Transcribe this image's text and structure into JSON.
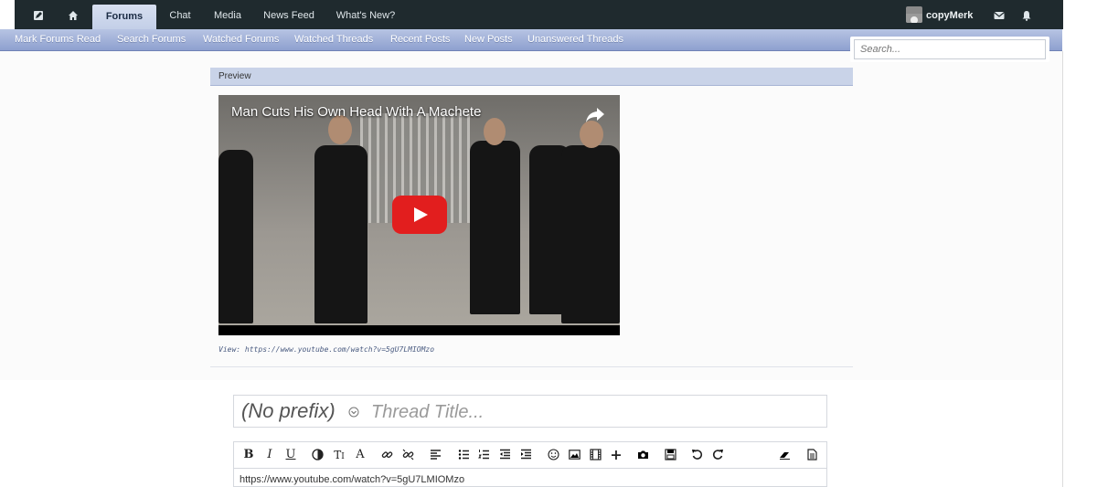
{
  "topnav": {
    "items": [
      {
        "label": "Forums"
      },
      {
        "label": "Chat"
      },
      {
        "label": "Media"
      },
      {
        "label": "News Feed"
      },
      {
        "label": "What's New?"
      }
    ],
    "username": "copyMerk"
  },
  "subnav": {
    "items": [
      {
        "label": "Mark Forums Read"
      },
      {
        "label": "Search Forums"
      },
      {
        "label": "Watched Forums"
      },
      {
        "label": "Watched Threads"
      },
      {
        "label": "Recent Posts"
      },
      {
        "label": "New Posts"
      },
      {
        "label": "Unanswered Threads"
      }
    ]
  },
  "search": {
    "placeholder": "Search..."
  },
  "preview": {
    "label": "Preview",
    "video_title": "Man Cuts His Own Head With A Machete",
    "view_label": "View:",
    "view_url": "https://www.youtube.com/watch?v=5gU7LMIOMzo"
  },
  "editor": {
    "prefix": "(No prefix)",
    "title_placeholder": "Thread Title...",
    "body_text": "https://www.youtube.com/watch?v=5gU7LMIOMzo"
  },
  "colors": {
    "topnav_bg": "#1f2a2e",
    "subnav_bg": "#9aaad6",
    "preview_bar": "#c9d3e8",
    "play_red": "#e21e1e"
  }
}
